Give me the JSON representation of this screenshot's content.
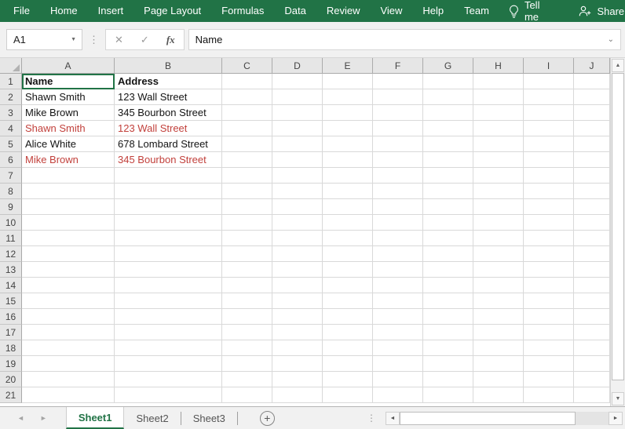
{
  "ribbon": {
    "bg_color": "#217346",
    "tabs": [
      "File",
      "Home",
      "Insert",
      "Page Layout",
      "Formulas",
      "Data",
      "Review",
      "View",
      "Help",
      "Team"
    ],
    "tell_me_label": "Tell me",
    "share_label": "Share"
  },
  "formula_bar": {
    "name_box_value": "A1",
    "cancel_icon": "✕",
    "enter_icon": "✓",
    "function_icon": "fx",
    "content": "Name"
  },
  "grid": {
    "selected_cell": "A1",
    "columns": [
      "A",
      "B",
      "C",
      "D",
      "E",
      "F",
      "G",
      "H",
      "I",
      "J"
    ],
    "visible_rows": 21,
    "red_text_color": "#C2413C",
    "cells": [
      {
        "ref": "A1",
        "text": "Name",
        "bold": true
      },
      {
        "ref": "B1",
        "text": "Address",
        "bold": true
      },
      {
        "ref": "A2",
        "text": "Shawn Smith"
      },
      {
        "ref": "B2",
        "text": "123 Wall Street"
      },
      {
        "ref": "A3",
        "text": "Mike Brown"
      },
      {
        "ref": "B3",
        "text": "345 Bourbon Street"
      },
      {
        "ref": "A4",
        "text": "Shawn Smith",
        "red": true
      },
      {
        "ref": "B4",
        "text": "123 Wall Street",
        "red": true
      },
      {
        "ref": "A5",
        "text": "Alice White"
      },
      {
        "ref": "B5",
        "text": "678 Lombard Street"
      },
      {
        "ref": "A6",
        "text": "Mike Brown",
        "red": true
      },
      {
        "ref": "B6",
        "text": "345 Bourbon Street",
        "red": true
      }
    ]
  },
  "sheet_bar": {
    "tabs": [
      {
        "label": "Sheet1",
        "active": true
      },
      {
        "label": "Sheet2",
        "active": false
      },
      {
        "label": "Sheet3",
        "active": false
      }
    ],
    "add_sheet_label": "+"
  },
  "icons": {
    "name_box_dropdown": "▼",
    "scroll_up": "▲",
    "scroll_down": "▼",
    "scroll_left": "◄",
    "scroll_right": "►",
    "nav_left": "◄",
    "nav_right": "►",
    "expand_formula_bar": "⌄",
    "separator_dots": "⋮"
  }
}
